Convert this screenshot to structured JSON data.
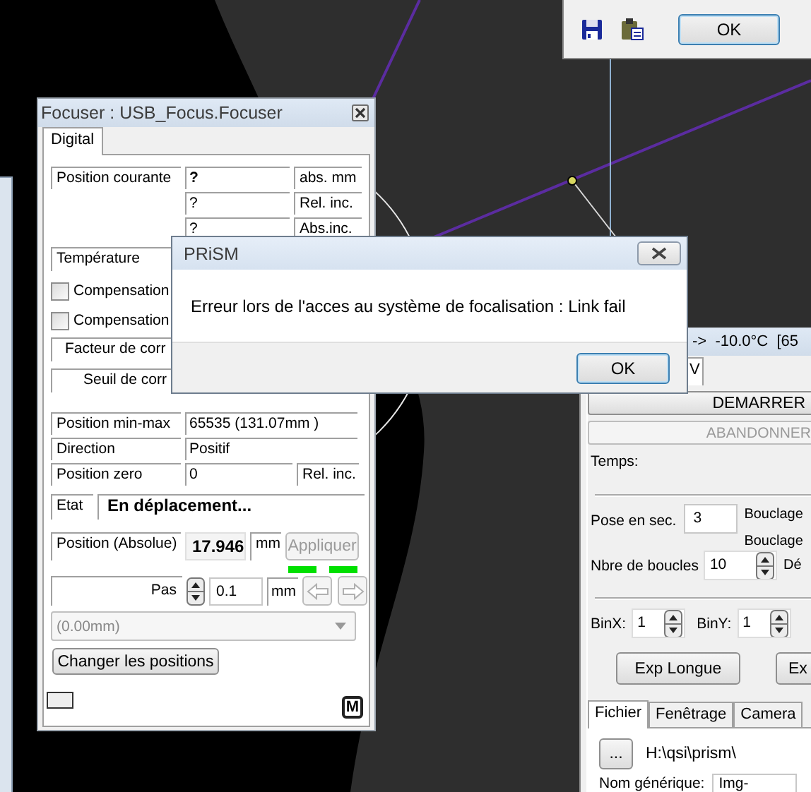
{
  "top_window": {
    "buttons": [
      {
        "label": "OK"
      }
    ]
  },
  "focuser": {
    "title": "Focuser : USB_Focus.Focuser",
    "tabs": [
      {
        "label": "Digital",
        "selected": true
      }
    ],
    "position_rows": [
      {
        "label": "Position courante",
        "value": "?",
        "bold": true,
        "unit": "abs. mm"
      },
      {
        "value": "?",
        "bold": false,
        "unit": "Rel. inc."
      },
      {
        "value": "?",
        "bold": false,
        "unit": "Abs.inc."
      }
    ],
    "temperature_label": "Température",
    "compensations": [
      {
        "label": "Compensation",
        "checked": false
      },
      {
        "label": "Compensation",
        "checked": false
      }
    ],
    "correction_labels": [
      "Facteur de corr",
      "Seuil de corr"
    ],
    "info_rows": [
      {
        "label": "Position min-max",
        "value": "65535 (131.07mm )"
      },
      {
        "label": "Direction",
        "value": "Positif"
      },
      {
        "label": "Position zero",
        "value": "0",
        "unit": "Rel. inc."
      }
    ],
    "state": {
      "label": "Etat",
      "value": "En déplacement..."
    },
    "absolute": {
      "label": "Position (Absolue)",
      "value": "17.946",
      "unit": "mm",
      "button": {
        "label": "Appliquer",
        "disabled": true
      }
    },
    "indicators": [
      {
        "on": true
      },
      {
        "on": true
      }
    ],
    "step": {
      "label": "Pas",
      "value": "0.1",
      "unit": "mm"
    },
    "arrow_buttons": [
      {
        "kind": "left",
        "disabled": true
      },
      {
        "kind": "right",
        "disabled": true
      }
    ],
    "preset": {
      "value": "(0.00mm)",
      "disabled": true
    },
    "change_button": {
      "label": "Changer les positions"
    },
    "mode_button": {
      "label": "M"
    }
  },
  "dialog": {
    "title": "PRiSM",
    "message": "Erreur lors de l'acces au système de focalisation : Link fail",
    "buttons": [
      {
        "label": "OK"
      }
    ]
  },
  "camera_window": {
    "title": "->  -10.0°C  [65",
    "top_tabs": [
      {
        "label": "V",
        "selected": true
      }
    ],
    "action_buttons": [
      {
        "label": "DEMARRER",
        "disabled": false
      },
      {
        "label": "ABANDONNER",
        "disabled": true
      }
    ],
    "time_label": "Temps:",
    "exposure": {
      "label": "Pose en sec.",
      "value": "3"
    },
    "loop_labels": [
      "Bouclage",
      "Bouclage"
    ],
    "loops": {
      "label": "Nbre de boucles",
      "value": "10",
      "after": "Dé"
    },
    "binning": [
      {
        "label": "BinX:",
        "value": "1"
      },
      {
        "label": "BinY:",
        "value": "1"
      }
    ],
    "exp_buttons": [
      {
        "label": "Exp Longue"
      },
      {
        "label": "Ex"
      }
    ],
    "tabs": [
      {
        "label": "Fichier",
        "selected": true
      },
      {
        "label": "Fenêtrage",
        "selected": false
      },
      {
        "label": "Camera",
        "selected": false
      }
    ],
    "browse_button": {
      "label": "..."
    },
    "path": "H:\\qsi\\prism\\",
    "name_label": "Nom générique:",
    "name_value": "Img-"
  }
}
